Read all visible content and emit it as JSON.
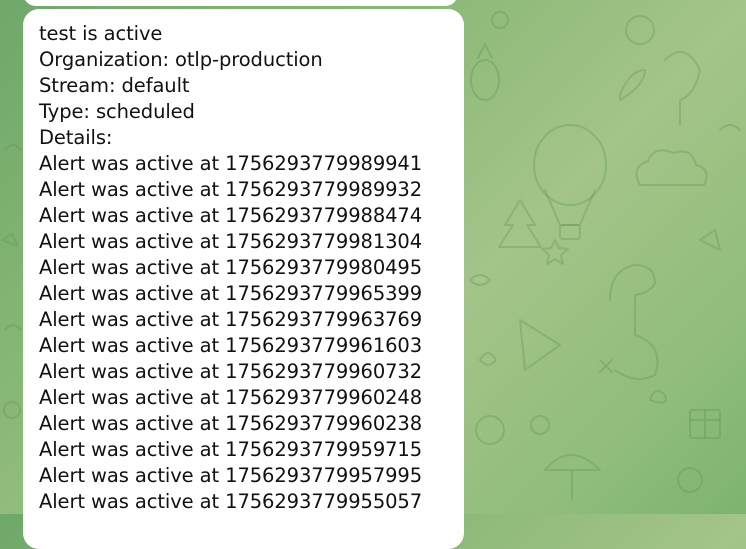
{
  "message": {
    "header_lines": [
      "test is active",
      "Organization: otlp-production",
      "Stream: default",
      "Type: scheduled",
      "Details:"
    ],
    "alert_lines": [
      "Alert was active at 1756293779989941",
      "Alert was active at 1756293779989932",
      "Alert was active at 1756293779988474",
      "Alert was active at 1756293779981304",
      "Alert was active at 1756293779980495",
      "Alert was active at 1756293779965399",
      "Alert was active at 1756293779963769",
      "Alert was active at 1756293779961603",
      "Alert was active at 1756293779960732",
      "Alert was active at 1756293779960248",
      "Alert was active at 1756293779960238",
      "Alert was active at 1756293779959715",
      "Alert was active at 1756293779957995",
      "Alert was active at 1756293779955057"
    ]
  },
  "colors": {
    "bubble": "#ffffff",
    "text": "#111111",
    "wallpaper": "#86b774"
  }
}
